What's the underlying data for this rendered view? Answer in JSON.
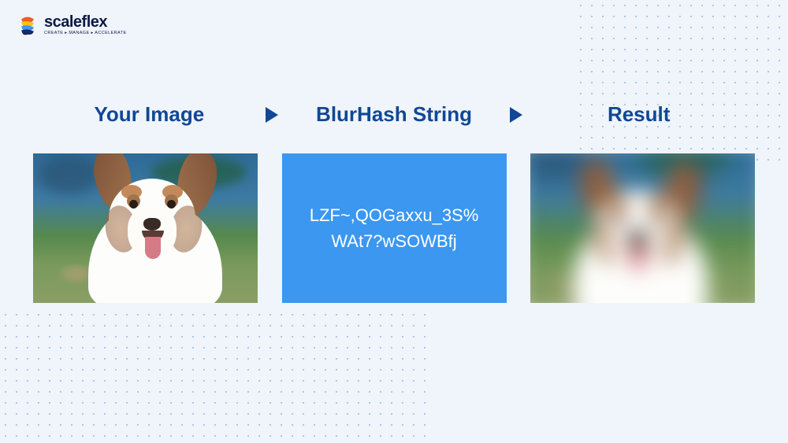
{
  "brand": {
    "name": "scaleflex",
    "tagline": "CREATE ▸ MANAGE ▸ ACCELERATE"
  },
  "headings": {
    "source": "Your Image",
    "hash": "BlurHash String",
    "result": "Result"
  },
  "blurhash": {
    "line1": "LZF~,QOGaxxu_3S%",
    "line2": "WAt7?wSOWBfj"
  }
}
